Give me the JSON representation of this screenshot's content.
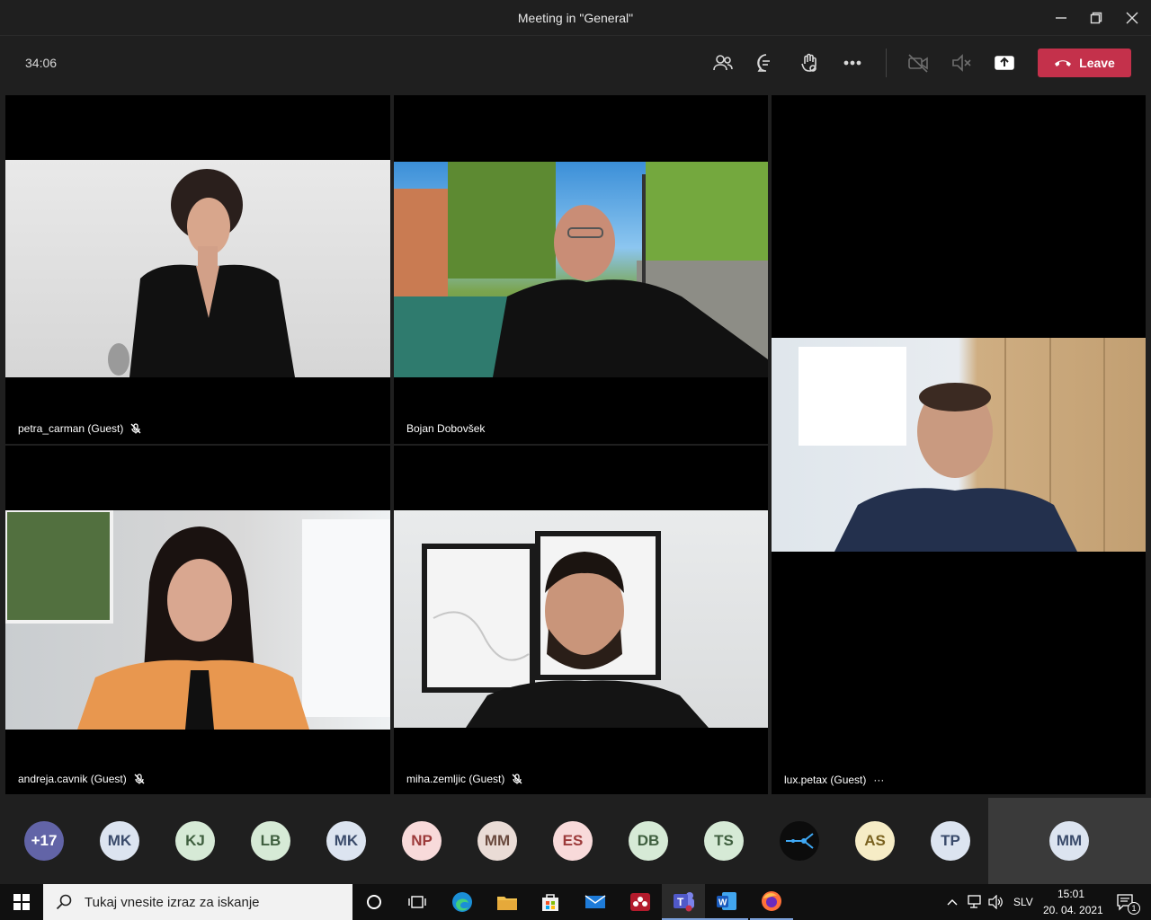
{
  "window": {
    "title": "Meeting in \"General\""
  },
  "toolbar": {
    "timer": "34:06",
    "leave_label": "Leave"
  },
  "participants": [
    {
      "name": "petra_carman (Guest)",
      "muted": true
    },
    {
      "name": "Bojan Dobovšek",
      "muted": false
    },
    {
      "name": "lux.petax (Guest)",
      "muted": false,
      "more": "···"
    },
    {
      "name": "andreja.cavnik (Guest)",
      "muted": true
    },
    {
      "name": "miha.zemljic (Guest)",
      "muted": true
    }
  ],
  "roster": [
    {
      "initials": "+17",
      "bg": "#6264a7",
      "fg": "#ffffff"
    },
    {
      "initials": "MK",
      "bg": "#dce4f0",
      "fg": "#3a4b6b"
    },
    {
      "initials": "KJ",
      "bg": "#d6ead6",
      "fg": "#3f5f3f"
    },
    {
      "initials": "LB",
      "bg": "#d6ead6",
      "fg": "#3f5f3f"
    },
    {
      "initials": "MK",
      "bg": "#dce4f0",
      "fg": "#3a4b6b"
    },
    {
      "initials": "NP",
      "bg": "#f8dada",
      "fg": "#9c3a3a"
    },
    {
      "initials": "MM",
      "bg": "#eadcd6",
      "fg": "#6a4a3e"
    },
    {
      "initials": "ES",
      "bg": "#f8dada",
      "fg": "#9c3a3a"
    },
    {
      "initials": "DB",
      "bg": "#d6ead6",
      "fg": "#3f5f3f"
    },
    {
      "initials": "TS",
      "bg": "#d6ead6",
      "fg": "#3f5f3f"
    },
    {
      "initials": "",
      "bg": "#0c0c0c",
      "fg": "#3fa9f5",
      "icon": "network-icon"
    },
    {
      "initials": "AS",
      "bg": "#f6ecc6",
      "fg": "#7a6220"
    },
    {
      "initials": "TP",
      "bg": "#dce4f0",
      "fg": "#3a4b6b"
    },
    {
      "initials": "MM",
      "bg": "#dce4f0",
      "fg": "#3a4b6b"
    }
  ],
  "taskbar": {
    "search_placeholder": "Tukaj vnesite izraz za iskanje",
    "language": "SLV",
    "time": "15:01",
    "date": "20. 04. 2021",
    "notification_count": "1"
  },
  "colors": {
    "leave": "#c4314b",
    "app_bg": "#1f1f1f",
    "tile_bg": "#000000",
    "teams": "#6264a7"
  }
}
